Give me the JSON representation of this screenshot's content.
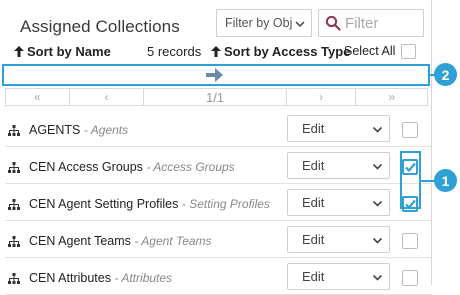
{
  "header": {
    "title": "Assigned Collections",
    "filter_select": "Filter by Obj",
    "filter_placeholder": "Filter"
  },
  "sortbar": {
    "sort_by_name": "Sort by Name",
    "records": "5 records",
    "sort_by_access_type": "Sort by Access Type",
    "select_all": "Select All"
  },
  "pager": {
    "first": "«",
    "prev": "‹",
    "current": "1/1",
    "next": "›",
    "last": "»"
  },
  "rows": [
    {
      "name": "AGENTS",
      "type": "- Agents",
      "access": "Edit",
      "checked": false
    },
    {
      "name": "CEN Access Groups",
      "type": "- Access Groups",
      "access": "Edit",
      "checked": true
    },
    {
      "name": "CEN Agent Setting Profiles",
      "type": "- Setting Profiles",
      "access": "Edit",
      "checked": true
    },
    {
      "name": "CEN Agent Teams",
      "type": "- Agent Teams",
      "access": "Edit",
      "checked": false
    },
    {
      "name": "CEN Attributes",
      "type": "- Attributes",
      "access": "Edit",
      "checked": false
    }
  ],
  "callouts": {
    "one": "1",
    "two": "2"
  },
  "icons": {
    "sort": "up-arrow-icon",
    "move": "right-arrow-icon",
    "search": "search-icon",
    "row": "hierarchy-icon",
    "dropdown": "chevron-down-icon",
    "check": "checkmark-icon"
  },
  "colors": {
    "accent": "#2fa0d6",
    "move_arrow": "#6c8aa6",
    "search_icon": "#8a3a58"
  }
}
